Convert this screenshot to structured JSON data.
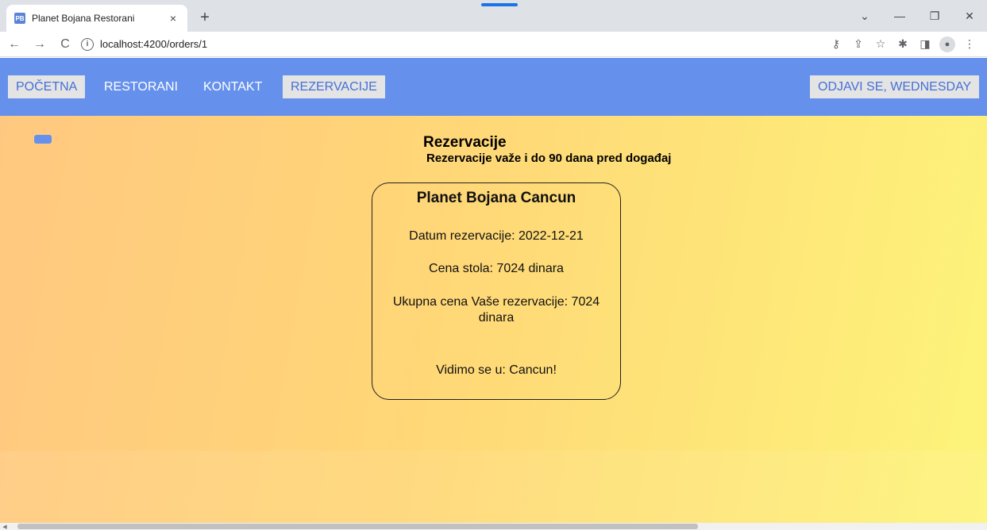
{
  "browser": {
    "tab_title": "Planet Bojana Restorani",
    "favicon_text": "PB",
    "tab_close": "×",
    "new_tab": "+",
    "url": "localhost:4200/orders/1",
    "win_controls": [
      "⌄",
      "—",
      "❐",
      "✕"
    ],
    "nav": {
      "back": "←",
      "forward": "→",
      "reload": "C"
    },
    "toolbar_icons": [
      "key-icon",
      "share-icon",
      "star-icon",
      "puzzle-icon",
      "sidepanel-icon",
      "profile-icon",
      "menu-icon"
    ]
  },
  "navbar": {
    "items": [
      {
        "label": "POČETNA",
        "style": "light"
      },
      {
        "label": "RESTORANI",
        "style": "plain"
      },
      {
        "label": "KONTAKT",
        "style": "plain"
      },
      {
        "label": "REZERVACIJE",
        "style": "light"
      }
    ],
    "logout": "ODJAVI SE, WEDNESDAY",
    "color": "#6591ec"
  },
  "main": {
    "heading": "Rezervacije",
    "subheading": "Rezervacije važe i do 90 dana pred događaj"
  },
  "card": {
    "title": "Planet Bojana Cancun",
    "date_line": "Datum rezervacije: 2022-12-21",
    "price_line": "Cena stola: 7024 dinara",
    "total_line": "Ukupna cena Vaše rezervacije: 7024 dinara",
    "farewell": "Vidimo se u: Cancun!"
  },
  "colors": {
    "gradient_start": "#ffc880",
    "gradient_end": "#fdf47a",
    "accent": "#6591ec"
  }
}
